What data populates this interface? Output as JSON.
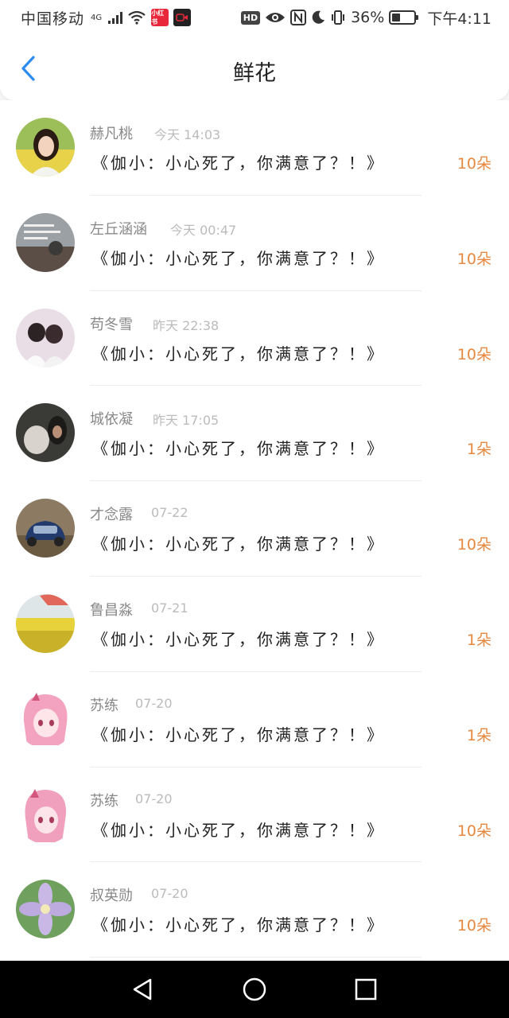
{
  "status_bar": {
    "carrier": "中国移动",
    "network": "4G",
    "app_badges": [
      "小红书",
      "录"
    ],
    "hd": "HD",
    "battery_percent": "36%",
    "battery_level": 0.36,
    "time": "下午4:11"
  },
  "header": {
    "title": "鲜花",
    "back_icon": "chevron-left-icon"
  },
  "list": {
    "items": [
      {
        "name": "赫凡桃",
        "time": "今天 14:03",
        "message": "《伽小：小心死了，你满意了？！》",
        "amount": "10朵"
      },
      {
        "name": "左丘涵涵",
        "time": "今天 00:47",
        "message": "《伽小：小心死了，你满意了？！》",
        "amount": "10朵"
      },
      {
        "name": "苟冬雪",
        "time": "昨天 22:38",
        "message": "《伽小：小心死了，你满意了？！》",
        "amount": "10朵"
      },
      {
        "name": "城依凝",
        "time": "昨天 17:05",
        "message": "《伽小：小心死了，你满意了？！》",
        "amount": "1朵"
      },
      {
        "name": "才念露",
        "time": "07-22",
        "message": "《伽小：小心死了，你满意了？！》",
        "amount": "10朵"
      },
      {
        "name": "鲁昌淼",
        "time": "07-21",
        "message": "《伽小：小心死了，你满意了？！》",
        "amount": "1朵"
      },
      {
        "name": "苏练",
        "time": "07-20",
        "message": "《伽小：小心死了，你满意了？！》",
        "amount": "1朵"
      },
      {
        "name": "苏练",
        "time": "07-20",
        "message": "《伽小：小心死了，你满意了？！》",
        "amount": "10朵"
      },
      {
        "name": "叔英勋",
        "time": "07-20",
        "message": "《伽小：小心死了，你满意了？！》",
        "amount": "10朵"
      }
    ]
  },
  "nav_bar": {
    "icons": [
      "back-triangle-icon",
      "home-circle-icon",
      "recents-square-icon"
    ]
  },
  "colors": {
    "accent_blue": "#2d8cf0",
    "amount_orange": "#e6883f"
  }
}
